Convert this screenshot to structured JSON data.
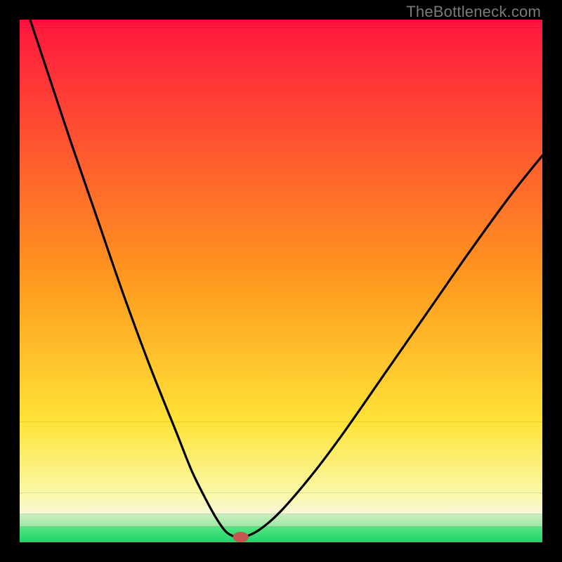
{
  "watermark": "TheBottleneck.com",
  "chart_data": {
    "type": "line",
    "title": "",
    "xlabel": "",
    "ylabel": "",
    "xlim": [
      0,
      1
    ],
    "ylim": [
      0,
      1
    ],
    "grid": false,
    "legend": false,
    "series": [
      {
        "name": "curve",
        "x": [
          0.02,
          0.05,
          0.1,
          0.15,
          0.2,
          0.25,
          0.3,
          0.33,
          0.36,
          0.38,
          0.395,
          0.408,
          0.418,
          0.43,
          0.46,
          0.5,
          0.56,
          0.62,
          0.7,
          0.78,
          0.86,
          0.94,
          1.0
        ],
        "y": [
          1.0,
          0.91,
          0.76,
          0.615,
          0.47,
          0.335,
          0.21,
          0.135,
          0.075,
          0.04,
          0.02,
          0.012,
          0.01,
          0.01,
          0.025,
          0.06,
          0.13,
          0.21,
          0.325,
          0.44,
          0.555,
          0.665,
          0.74
        ]
      }
    ],
    "bands": [
      {
        "name": "top-red",
        "y0": 0.985,
        "y1": 1.0,
        "color_top": "#ff0a3f",
        "color_bottom": "#ff1a3e"
      },
      {
        "name": "red-orange",
        "y0": 0.5,
        "y1": 0.985,
        "color_top": "#ff1a3e",
        "color_bottom": "#ff9a1f"
      },
      {
        "name": "orange-yellow",
        "y0": 0.23,
        "y1": 0.5,
        "color_top": "#ff9a1f",
        "color_bottom": "#ffe337"
      },
      {
        "name": "yellow-pale",
        "y0": 0.095,
        "y1": 0.23,
        "color_top": "#ffe337",
        "color_bottom": "#faf8a6"
      },
      {
        "name": "cream",
        "y0": 0.055,
        "y1": 0.095,
        "color_top": "#faf8a6",
        "color_bottom": "#f7f7d6"
      },
      {
        "name": "pale-green",
        "y0": 0.03,
        "y1": 0.055,
        "color_top": "#cdeec0",
        "color_bottom": "#9fe7a6"
      },
      {
        "name": "green",
        "y0": 0.0,
        "y1": 0.03,
        "color_top": "#55e583",
        "color_bottom": "#1fd36b"
      }
    ],
    "marker": {
      "name": "valley-marker",
      "x": 0.423,
      "y": 0.01,
      "rx": 0.015,
      "ry": 0.01,
      "fill": "#c1574f"
    }
  }
}
